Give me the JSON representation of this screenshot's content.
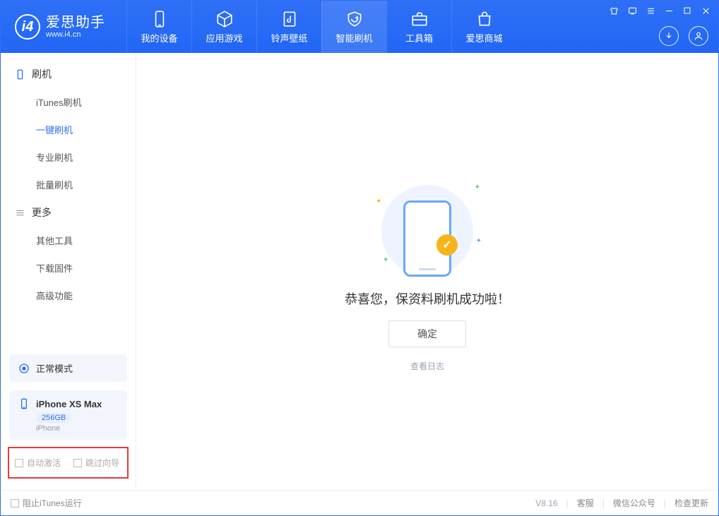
{
  "app": {
    "name": "爱思助手",
    "url": "www.i4.cn"
  },
  "nav": {
    "my_device": "我的设备",
    "apps_games": "应用游戏",
    "ringtone_wallpaper": "铃声壁纸",
    "smart_flash": "智能刷机",
    "toolbox": "工具箱",
    "store": "爱思商城"
  },
  "sidebar": {
    "group_flash": "刷机",
    "items_flash": {
      "itunes": "iTunes刷机",
      "onekey": "一键刷机",
      "pro": "专业刷机",
      "batch": "批量刷机"
    },
    "group_more": "更多",
    "items_more": {
      "other_tools": "其他工具",
      "download_fw": "下载固件",
      "advanced": "高级功能"
    },
    "mode": "正常模式",
    "device": {
      "name": "iPhone XS Max",
      "capacity": "256GB",
      "type": "iPhone"
    },
    "auto_activate": "自动激活",
    "skip_guide": "跳过向导"
  },
  "main": {
    "success": "恭喜您，保资料刷机成功啦！",
    "ok": "确定",
    "view_log": "查看日志"
  },
  "status": {
    "block_itunes": "阻止iTunes运行",
    "version": "V8.16",
    "support": "客服",
    "wechat": "微信公众号",
    "update": "检查更新"
  }
}
